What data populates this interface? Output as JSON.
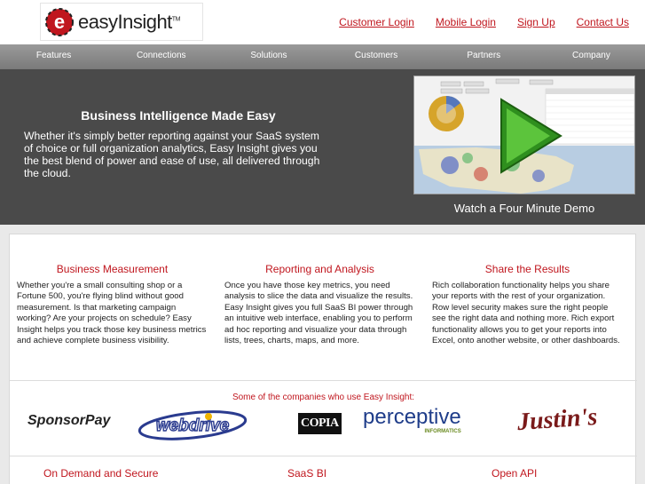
{
  "header": {
    "logo_text": "easyInsight",
    "logo_tm": "TM",
    "links": [
      "Customer Login",
      "Mobile Login",
      "Sign Up",
      "Contact Us"
    ]
  },
  "nav": {
    "items": [
      "Features",
      "Connections",
      "Solutions",
      "Customers",
      "Partners",
      "Company"
    ]
  },
  "hero": {
    "title": "Business Intelligence Made Easy",
    "text": "Whether it's simply better reporting against your SaaS system of choice or full organization analytics, Easy Insight gives you the best blend of power and ease of use, all delivered through the cloud.",
    "demo_caption": "Watch a Four Minute Demo"
  },
  "features": [
    {
      "title": "Business Measurement",
      "text": "Whether you're a small consulting shop or a Fortune 500, you're flying blind without good measurement. Is that marketing campaign working? Are your projects on schedule? Easy Insight helps you track those key business metrics and achieve complete business visibility."
    },
    {
      "title": "Reporting and Analysis",
      "text": "Once you have those key metrics, you need analysis to slice the data and visualize the results. Easy Insight gives you full SaaS BI power through an intuitive web interface, enabling you to perform ad hoc reporting and visualize your data through lists, trees, charts, maps, and more."
    },
    {
      "title": "Share the Results",
      "text": "Rich collaboration functionality helps you share your reports with the rest of your organization. Row level security makes sure the right people see the right data and nothing more. Rich export functionality allows you to get your reports into Excel, onto another website, or other dashboards."
    }
  ],
  "companies": {
    "title": "Some of the companies who use Easy Insight:",
    "logos": {
      "sponsorpay": "SponsorPay",
      "webdrive": "webdrive",
      "copia": "COPIA",
      "perceptive": "perceptive",
      "perceptive_sub": "INFORMATICS",
      "justins": "Justin's"
    }
  },
  "bottom": [
    "On Demand and Secure",
    "SaaS BI",
    "Open API"
  ],
  "colors": {
    "accent": "#c0161e",
    "nav": "#8a8a8a",
    "hero": "#4a4a4a",
    "play": "#3fa52a"
  }
}
